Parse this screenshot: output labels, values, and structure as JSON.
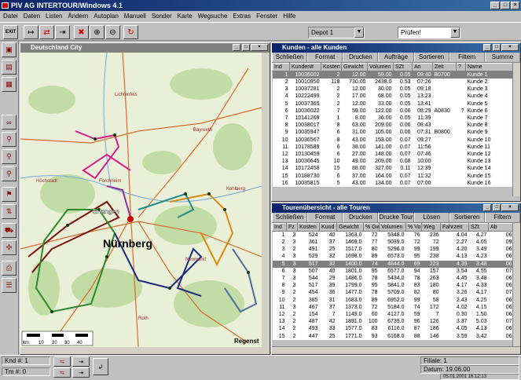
{
  "app": {
    "title": "PIV AG  INTERTOUR/Windows 4.1"
  },
  "menu": [
    "Datei",
    "Daten",
    "Listen",
    "Ändern",
    "Autoplan",
    "Manuell",
    "Sonder",
    "Karte",
    "Wegsuche",
    "Extras",
    "Fenster",
    "Hilfe"
  ],
  "toolbar": {
    "exit": "EXIT",
    "depot": "Depot 1",
    "pruefen": "Prüfen!"
  },
  "map": {
    "title": "Deutschland City",
    "city": "Nürnberg",
    "places": [
      "Erlangen",
      "Forchheim",
      "Regenst",
      "Bayreuth",
      "Neumarkt",
      "Kohlberg",
      "Roth",
      "Lichtenfels",
      "Höchstadt"
    ],
    "scale_unit": "km",
    "scale_ticks": [
      "10",
      "20",
      "30",
      "40"
    ],
    "colors": {
      "water": "#6fa8dc",
      "road": "#d86a2a",
      "forest": "#2f7a2f"
    }
  },
  "kunden": {
    "title": "Kunden - alle Kunden",
    "buttons": [
      "Schließen",
      "Format",
      "Drucken",
      "Aufträge",
      "Sortieren",
      "Filtern",
      "Summe"
    ],
    "columns": [
      "Ind",
      "Kunden#",
      "Kosten",
      "Gewicht",
      "Volumen",
      "SZt",
      "An",
      "Zeit",
      "?",
      "Name"
    ],
    "rows": [
      [
        "1",
        "10036002",
        "2",
        "12.00",
        "59.00",
        "0.05",
        "09:40",
        "B0700",
        "",
        "Kunde 1"
      ],
      [
        "2",
        "10010950",
        "118",
        "730.00",
        "2438.0",
        "0.53",
        "07:26",
        "",
        "",
        "Kunde 2"
      ],
      [
        "3",
        "10037281",
        "2",
        "12.00",
        "30.00",
        "0.05",
        "09:18",
        "",
        "",
        "Kunde 3"
      ],
      [
        "4",
        "10222499",
        "2",
        "17.00",
        "68.00",
        "0.05",
        "13:23",
        "",
        "",
        "Kunde 4"
      ],
      [
        "5",
        "10037365",
        "2",
        "12.00",
        "33.00",
        "0.05",
        "13:41",
        "",
        "",
        "Kunde 5"
      ],
      [
        "6",
        "10036022",
        "7",
        "59.00",
        "122.00",
        "0.06",
        "08:29",
        "A0830",
        "?",
        "Kunde 6"
      ],
      [
        "7",
        "10141269",
        "1",
        "8.00",
        "36.00",
        "0.05",
        "11:39",
        "",
        "",
        "Kunde 7"
      ],
      [
        "8",
        "10038017",
        "8",
        "63.00",
        "209.00",
        "0.06",
        "08:43",
        "",
        "",
        "Kunde 8"
      ],
      [
        "9",
        "10035947",
        "6",
        "31.00",
        "105.00",
        "0.06",
        "07:31",
        "B0800",
        "",
        "Kunde 9"
      ],
      [
        "10",
        "10036567",
        "8",
        "43.00",
        "153.00",
        "0.07",
        "09:27",
        "",
        "",
        "Kunde 10"
      ],
      [
        "11",
        "10178589",
        "6",
        "38.00",
        "141.00",
        "0.07",
        "11:56",
        "",
        "",
        "Kunde 11"
      ],
      [
        "12",
        "10130459",
        "6",
        "27.00",
        "148.00",
        "0.07",
        "07:46",
        "",
        "",
        "Kunde 12"
      ],
      [
        "13",
        "10036645",
        "10",
        "49.00",
        "209.00",
        "0.08",
        "10:00",
        "",
        "",
        "Kunde 13"
      ],
      [
        "14",
        "10172458",
        "15",
        "88.00",
        "327.00",
        "0.11",
        "12:39",
        "",
        "",
        "Kunde 14"
      ],
      [
        "15",
        "10188730",
        "6",
        "37.00",
        "164.00",
        "0.07",
        "11:32",
        "",
        "",
        "Kunde 15"
      ],
      [
        "16",
        "10035815",
        "5",
        "43.00",
        "134.00",
        "0.07",
        "07:00",
        "",
        "",
        "Kunde 16"
      ]
    ]
  },
  "touren": {
    "title": "Tourenübersicht - alle Touren",
    "buttons": [
      "Schließen",
      "Format",
      "Drucken",
      "Drucke Tour",
      "Lösen",
      "Sortieren",
      "Filtern"
    ],
    "columns": [
      "Ind",
      "Fz",
      "Kosten",
      "Kund",
      "Gewicht",
      "% Gw",
      "Volumen",
      "% Vo",
      "Weg",
      "Fahrzeit",
      "SZt",
      "Ab"
    ],
    "rows": [
      [
        "1",
        "3",
        "524",
        "40",
        "1363.0",
        "72",
        "5348.0",
        "76",
        "236",
        "4.04",
        "4.27",
        "06"
      ],
      [
        "2",
        "3",
        "361",
        "37",
        "1469.0",
        "77",
        "5039.0",
        "72",
        "72",
        "2.27",
        "4.05",
        "09"
      ],
      [
        "3",
        "2",
        "491",
        "25",
        "1517.0",
        "80",
        "5296.0",
        "99",
        "199",
        "4.20",
        "3.49",
        "06"
      ],
      [
        "4",
        "3",
        "529",
        "32",
        "1698.0",
        "89",
        "6573.0",
        "95",
        "238",
        "4.13",
        "4.23",
        "06"
      ],
      [
        "5",
        "3",
        "517",
        "32",
        "1400.0",
        "74",
        "4844.0",
        "69",
        "223",
        "4.39",
        "3.48",
        "06"
      ],
      [
        "6",
        "3",
        "507",
        "40",
        "1801.0",
        "95",
        "6577.0",
        "94",
        "157",
        "3.54",
        "4.55",
        "07"
      ],
      [
        "7",
        "3",
        "544",
        "29",
        "1486.0",
        "78",
        "5434.0",
        "78",
        "263",
        "4.45",
        "3.48",
        "06"
      ],
      [
        "8",
        "3",
        "517",
        "39",
        "1799.0",
        "95",
        "5841.0",
        "83",
        "180",
        "4.17",
        "4.33",
        "06"
      ],
      [
        "9",
        "2",
        "454",
        "36",
        "1477.0",
        "78",
        "5709.0",
        "82",
        "80",
        "3.26",
        "4.17",
        "07"
      ],
      [
        "10",
        "2",
        "385",
        "31",
        "1683.0",
        "89",
        "6952.0",
        "99",
        "58",
        "2.43",
        "4.25",
        "06"
      ],
      [
        "11",
        "3",
        "467",
        "37",
        "1373.0",
        "72",
        "5184.0",
        "74",
        "172",
        "4.02",
        "4.15",
        "06"
      ],
      [
        "12",
        "2",
        "154",
        "7",
        "1149.0",
        "60",
        "4127.0",
        "59",
        "7",
        "0.30",
        "1.50",
        "06"
      ],
      [
        "13",
        "2",
        "487",
        "42",
        "1891.0",
        "100",
        "6739.0",
        "96",
        "126",
        "3.37",
        "5.03",
        "07"
      ],
      [
        "14",
        "2",
        "493",
        "33",
        "1577.0",
        "83",
        "6116.0",
        "87",
        "186",
        "4.05",
        "4.13",
        "06"
      ],
      [
        "15",
        "2",
        "447",
        "25",
        "1771.0",
        "93",
        "6168.0",
        "88",
        "146",
        "3.59",
        "3.42",
        "06"
      ]
    ]
  },
  "status": {
    "knd": "Knd #:  1",
    "tm": "Tm #:  0",
    "filiale": "Filiale: 1",
    "datum": "Datum: 19.06.00",
    "clock": "05.01.2001  16:12:13"
  }
}
